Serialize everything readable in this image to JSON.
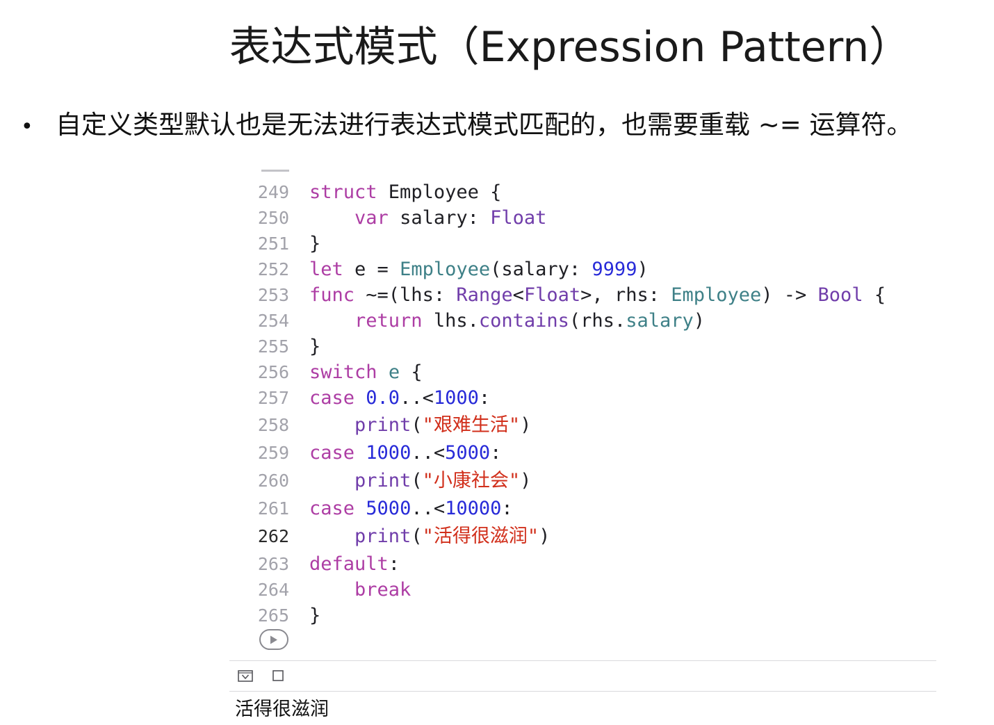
{
  "title": "表达式模式（Expression Pattern）",
  "bullet": {
    "marker": "•",
    "text": "自定义类型默认也是无法进行表达式模式匹配的，也需要重载 ~= 运算符。"
  },
  "editor": {
    "current_line": "262",
    "lines": [
      {
        "n": "249",
        "tokens": [
          [
            "kw",
            "struct"
          ],
          [
            "",
            " Employee {"
          ]
        ]
      },
      {
        "n": "250",
        "tokens": [
          [
            "",
            "    "
          ],
          [
            "kw",
            "var"
          ],
          [
            "",
            " salary: "
          ],
          [
            "ty",
            "Float"
          ]
        ]
      },
      {
        "n": "251",
        "tokens": [
          [
            "",
            "}"
          ]
        ]
      },
      {
        "n": "252",
        "tokens": [
          [
            "kw",
            "let"
          ],
          [
            "",
            " e = "
          ],
          [
            "pf",
            "Employee"
          ],
          [
            "",
            "(salary: "
          ],
          [
            "num",
            "9999"
          ],
          [
            "",
            ")"
          ]
        ]
      },
      {
        "n": "253",
        "tokens": [
          [
            "kw",
            "func"
          ],
          [
            "",
            " ~=(lhs: "
          ],
          [
            "ty",
            "Range"
          ],
          [
            "",
            "<"
          ],
          [
            "ty",
            "Float"
          ],
          [
            "",
            ">, rhs: "
          ],
          [
            "pf",
            "Employee"
          ],
          [
            "",
            ") -> "
          ],
          [
            "ty",
            "Bool"
          ],
          [
            "",
            " {"
          ]
        ]
      },
      {
        "n": "254",
        "tokens": [
          [
            "",
            "    "
          ],
          [
            "kw",
            "return"
          ],
          [
            "",
            " lhs."
          ],
          [
            "ty",
            "contains"
          ],
          [
            "",
            "(rhs."
          ],
          [
            "pf",
            "salary"
          ],
          [
            "",
            ")"
          ]
        ]
      },
      {
        "n": "255",
        "tokens": [
          [
            "",
            "}"
          ]
        ]
      },
      {
        "n": "256",
        "tokens": [
          [
            "kw",
            "switch"
          ],
          [
            "",
            " "
          ],
          [
            "pf",
            "e"
          ],
          [
            "",
            " {"
          ]
        ]
      },
      {
        "n": "257",
        "tokens": [
          [
            "kw",
            "case"
          ],
          [
            "",
            " "
          ],
          [
            "num",
            "0.0"
          ],
          [
            "",
            "..<"
          ],
          [
            "num",
            "1000"
          ],
          [
            "",
            ":"
          ]
        ]
      },
      {
        "n": "258",
        "tokens": [
          [
            "",
            "    "
          ],
          [
            "ty",
            "print"
          ],
          [
            "",
            "("
          ],
          [
            "str",
            "\"艰难生活\""
          ],
          [
            "",
            ")"
          ]
        ]
      },
      {
        "n": "259",
        "tokens": [
          [
            "kw",
            "case"
          ],
          [
            "",
            " "
          ],
          [
            "num",
            "1000"
          ],
          [
            "",
            "..<"
          ],
          [
            "num",
            "5000"
          ],
          [
            "",
            ":"
          ]
        ]
      },
      {
        "n": "260",
        "tokens": [
          [
            "",
            "    "
          ],
          [
            "ty",
            "print"
          ],
          [
            "",
            "("
          ],
          [
            "str",
            "\"小康社会\""
          ],
          [
            "",
            ")"
          ]
        ]
      },
      {
        "n": "261",
        "tokens": [
          [
            "kw",
            "case"
          ],
          [
            "",
            " "
          ],
          [
            "num",
            "5000"
          ],
          [
            "",
            "..<"
          ],
          [
            "num",
            "10000"
          ],
          [
            "",
            ":"
          ]
        ]
      },
      {
        "n": "262",
        "tokens": [
          [
            "",
            "    "
          ],
          [
            "ty",
            "print"
          ],
          [
            "",
            "("
          ],
          [
            "str",
            "\"活得很滋润\""
          ],
          [
            "",
            ")"
          ]
        ]
      },
      {
        "n": "263",
        "tokens": [
          [
            "kw",
            "default"
          ],
          [
            "",
            ":"
          ]
        ]
      },
      {
        "n": "264",
        "tokens": [
          [
            "",
            "    "
          ],
          [
            "kw",
            "break"
          ]
        ]
      },
      {
        "n": "265",
        "tokens": [
          [
            "",
            "}"
          ]
        ]
      }
    ]
  },
  "icons": {
    "run": "play-icon",
    "hide_debug": "hide-debug-area-icon",
    "clear": "clear-console-icon"
  },
  "console": {
    "output": "活得很滋润"
  }
}
